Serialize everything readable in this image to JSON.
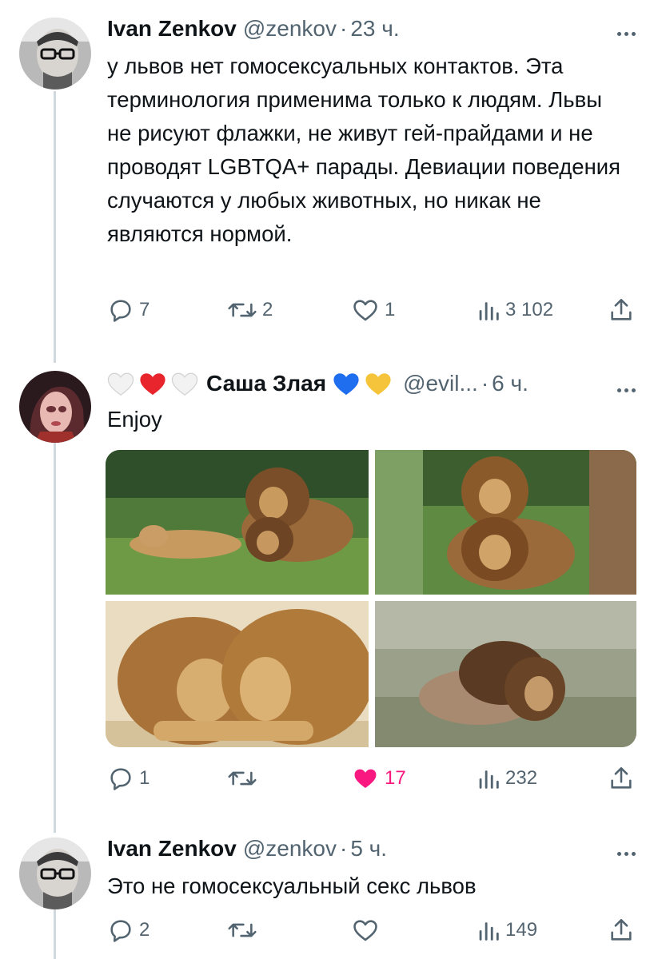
{
  "tweets": [
    {
      "author_name": "Ivan Zenkov",
      "handle": "@zenkov",
      "separator": "·",
      "time": "23 ч.",
      "text": "у львов нет гомосексуальных контактов. Эта терминология применима только к людям. Львы не рисуют флажки, не живут гей-прайдами и не проводят LGBTQA+ парады. Девиации поведения случаются у любых животных, но никак не являются нормой.",
      "replies": "7",
      "retweets": "2",
      "likes": "1",
      "views": "3 102"
    },
    {
      "author_name": "Саша Злая",
      "name_emojis_before": [
        "white-heart",
        "red-heart",
        "white-heart"
      ],
      "name_emojis_after": [
        "blue-heart",
        "yellow-heart"
      ],
      "handle": "@evil...",
      "separator": "·",
      "time": "6 ч.",
      "text": "Enjoy",
      "replies": "1",
      "retweets": "",
      "likes": "17",
      "liked": true,
      "views": "232",
      "media": [
        "lion-photo-1",
        "lion-photo-2",
        "lion-photo-3",
        "lion-photo-4"
      ]
    },
    {
      "author_name": "Ivan Zenkov",
      "handle": "@zenkov",
      "separator": "·",
      "time": "5 ч.",
      "text": "Это не гомосексуальный секс львов",
      "replies": "2",
      "retweets": "",
      "likes": "",
      "views": "149"
    }
  ],
  "colors": {
    "text": "#0f1419",
    "muted": "#536471",
    "like_active": "#f91880",
    "thread_line": "#cfd9de"
  },
  "icons": [
    "reply-icon",
    "retweet-icon",
    "like-icon",
    "views-icon",
    "share-icon",
    "more-icon"
  ]
}
